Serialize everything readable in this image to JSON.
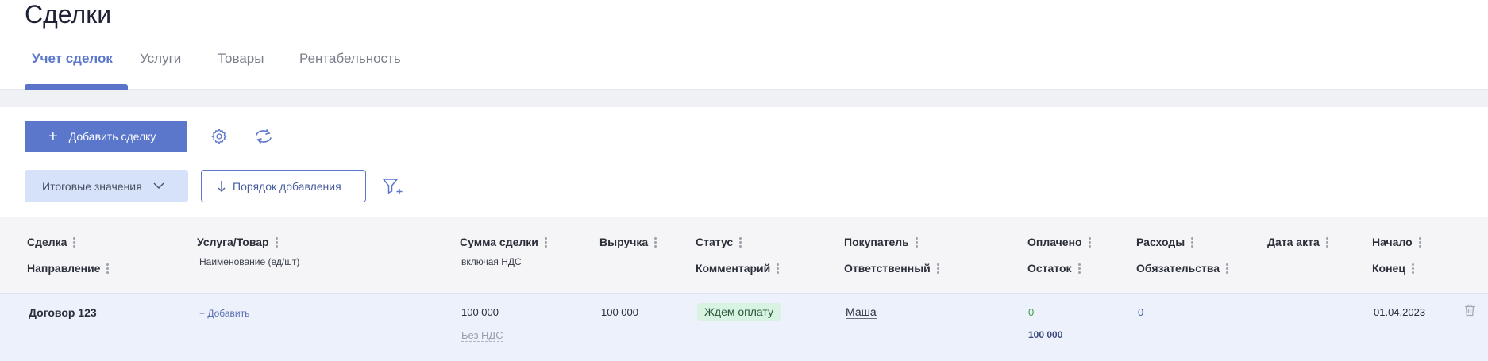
{
  "page": {
    "title": "Сделки"
  },
  "tabs": [
    {
      "label": "Учет сделок",
      "active": true
    },
    {
      "label": "Услуги",
      "active": false
    },
    {
      "label": "Товары",
      "active": false
    },
    {
      "label": "Рентабельность",
      "active": false
    }
  ],
  "toolbar": {
    "add_deal_label": "Добавить сделку",
    "add_icon": "+",
    "settings_icon": "gear-icon",
    "refresh_icon": "refresh-icon",
    "totals_label": "Итоговые значения",
    "order_label": "Порядок добавления",
    "filter_icon": "filter-add-icon"
  },
  "table": {
    "headers": {
      "deal": "Сделка",
      "direction": "Направление",
      "service": "Услуга/Товар",
      "service_sub": "Наименование (ед/шт)",
      "sum": "Сумма сделки",
      "sum_sub": "включая НДС",
      "revenue": "Выручка",
      "status": "Статус",
      "comment": "Комментарий",
      "buyer": "Покупатель",
      "responsible": "Ответственный",
      "paid": "Оплачено",
      "remaining": "Остаток",
      "expenses": "Расходы",
      "obligations": "Обязательства",
      "act_date": "Дата акта",
      "start": "Начало",
      "end": "Конец"
    },
    "rows": [
      {
        "deal": "Договор 123",
        "service_add": "+ Добавить",
        "sum": "100 000",
        "vat": "Без НДС",
        "revenue": "100 000",
        "status": "Ждем оплату",
        "buyer": "Маша",
        "paid": "0",
        "remaining": "100 000",
        "expenses": "0",
        "start": "01.04.2023"
      }
    ]
  },
  "colors": {
    "accent": "#5a77cc",
    "status_bg": "#d8f3e2",
    "row_bg": "#edf1fc"
  }
}
